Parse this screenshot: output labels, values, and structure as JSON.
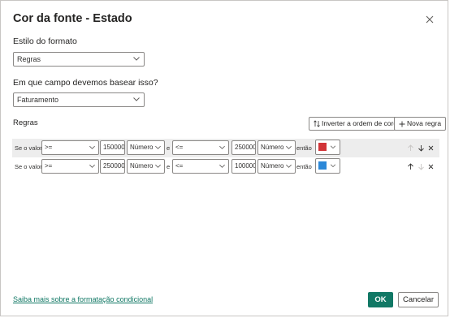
{
  "dialog": {
    "title": "Cor da fonte - Estado",
    "format_style_label": "Estilo do formato",
    "format_style_value": "Regras",
    "field_question": "Em que campo devemos basear isso?",
    "field_value": "Faturamento",
    "rules_label": "Regras",
    "invert_button": "Inverter a ordem de cores",
    "new_rule_button": "Nova regra",
    "learn_more_link": "Saiba mais sobre a formatação condicional",
    "ok_button": "OK",
    "cancel_button": "Cancelar"
  },
  "rules": [
    {
      "if_label": "Se o valor",
      "op1": ">=",
      "value1": "150000",
      "type1": "Número",
      "and_label": "e",
      "op2": "<=",
      "value2": "250000",
      "type2": "Número",
      "then_label": "então",
      "color": "#d13438"
    },
    {
      "if_label": "Se o valor",
      "op1": ">=",
      "value1": "250000",
      "type1": "Número",
      "and_label": "e",
      "op2": "<=",
      "value2": "100000",
      "type2": "Número",
      "then_label": "então",
      "color": "#2b88d8"
    }
  ],
  "icons": {
    "close": "close-icon",
    "chevron": "chevron-down-icon",
    "invert": "swap-order-icon",
    "add": "plus-icon",
    "up": "arrow-up-icon",
    "down": "arrow-down-icon",
    "delete": "delete-x-icon"
  }
}
